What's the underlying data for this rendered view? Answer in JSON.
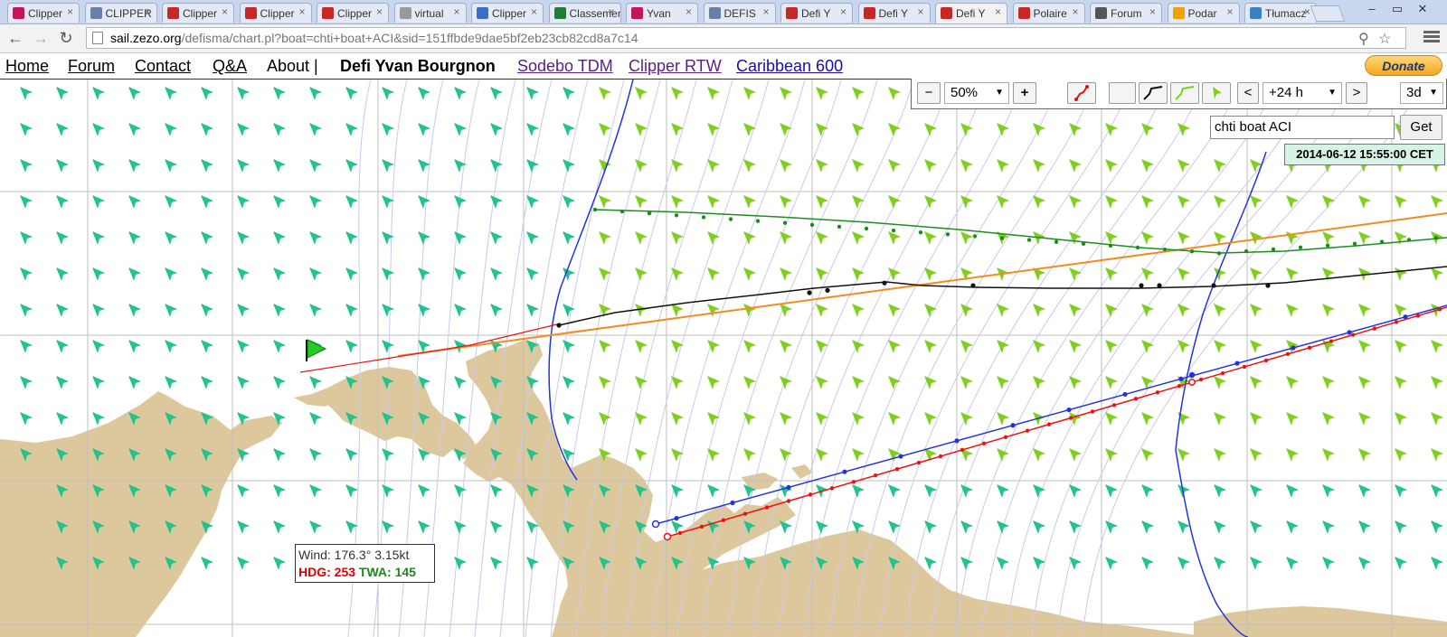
{
  "browser": {
    "tabs": [
      {
        "title": "Clipper",
        "color": "#c2185b"
      },
      {
        "title": "CLIPPER",
        "color": "#6a7fa8"
      },
      {
        "title": "Clipper",
        "color": "#c62828"
      },
      {
        "title": "Clipper",
        "color": "#c62828"
      },
      {
        "title": "Clipper",
        "color": "#c62828"
      },
      {
        "title": "virtual",
        "color": "#999999"
      },
      {
        "title": "Clipper",
        "color": "#3b6cc7"
      },
      {
        "title": "Classement",
        "color": "#1e7e34"
      },
      {
        "title": "Yvan",
        "color": "#c2185b"
      },
      {
        "title": "DEFIS",
        "color": "#6a7fa8"
      },
      {
        "title": "Defi Y",
        "color": "#c62828"
      },
      {
        "title": "Defi Y",
        "color": "#c62828"
      },
      {
        "title": "Defi Y",
        "color": "#c62828"
      },
      {
        "title": "Polaire",
        "color": "#c62828"
      },
      {
        "title": "Forum",
        "color": "#555555"
      },
      {
        "title": "Podar",
        "color": "#f0a000"
      },
      {
        "title": "Tłumacz",
        "color": "#3b82c4"
      }
    ],
    "active_tab_index": 12,
    "url_host": "sail.zezo.org",
    "url_path": "/defisma/chart.pl?boat=chti+boat+ACI&sid=151ffbde9dae5bf2eb23cb82cd8a7c14"
  },
  "site_nav": {
    "home": "Home",
    "forum": "Forum",
    "contact": "Contact",
    "qa": "Q&A",
    "about": "About |",
    "race_title": "Defi Yvan Bourgnon",
    "link_sodebo": "Sodebo TDM",
    "link_clipper": "Clipper RTW",
    "link_caribbean": "Caribbean 600",
    "donate": "Donate"
  },
  "controls": {
    "zoom_out": "−",
    "zoom_value": "50%",
    "zoom_in": "+",
    "time_prev": "<",
    "time_value": "+24 h",
    "time_next": ">",
    "mode_value": "3d",
    "search_value": "chti boat ACI",
    "get_button": "Get",
    "timestamp": "2014-06-12 15:55:00 CET"
  },
  "wind_info": {
    "wind_label": "Wind: 176.3° 3.15kt",
    "hdg_label": "HDG: 253",
    "twa_label": "TWA: 145"
  },
  "colors": {
    "land": "#dcc89c",
    "grid": "#bfbfbf",
    "isochrone": "#c7c9ef",
    "wind_arrow_green": "#7fcf1f",
    "wind_arrow_teal": "#22c48c",
    "route_green": "#1e8c1e",
    "route_black": "#111111",
    "route_orange": "#f28c1e",
    "route_blue": "#2233dd",
    "route_red": "#ee1111",
    "flag": "#22cc22"
  }
}
